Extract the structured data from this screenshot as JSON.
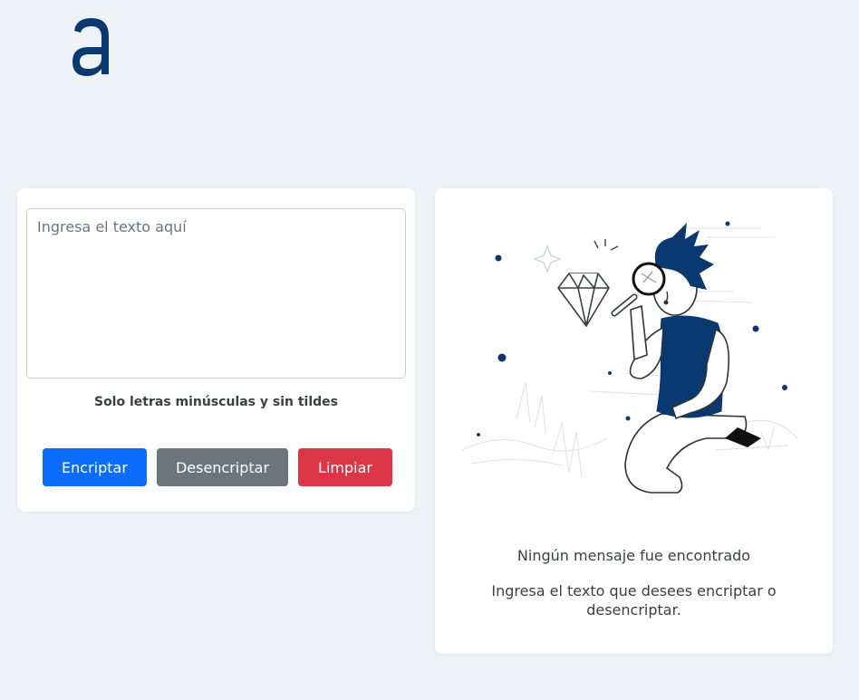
{
  "brand": {
    "logo_icon": "letter-a-logo-icon",
    "color": "#0a3871"
  },
  "encoder": {
    "input_placeholder": "Ingresa el texto aquí",
    "input_value": "",
    "hint": "Solo letras minúsculas y sin tildes",
    "buttons": {
      "encrypt": "Encriptar",
      "decrypt": "Desencriptar",
      "clear": "Limpiar"
    },
    "colors": {
      "encrypt": "#0d6efd",
      "decrypt": "#6c757d",
      "clear": "#dc3545"
    }
  },
  "output": {
    "illustration_icon": "person-with-magnifying-glass-illustration",
    "title": "Ningún mensaje fue encontrado",
    "subtitle": "Ingresa el texto que desees encriptar o desencriptar."
  }
}
